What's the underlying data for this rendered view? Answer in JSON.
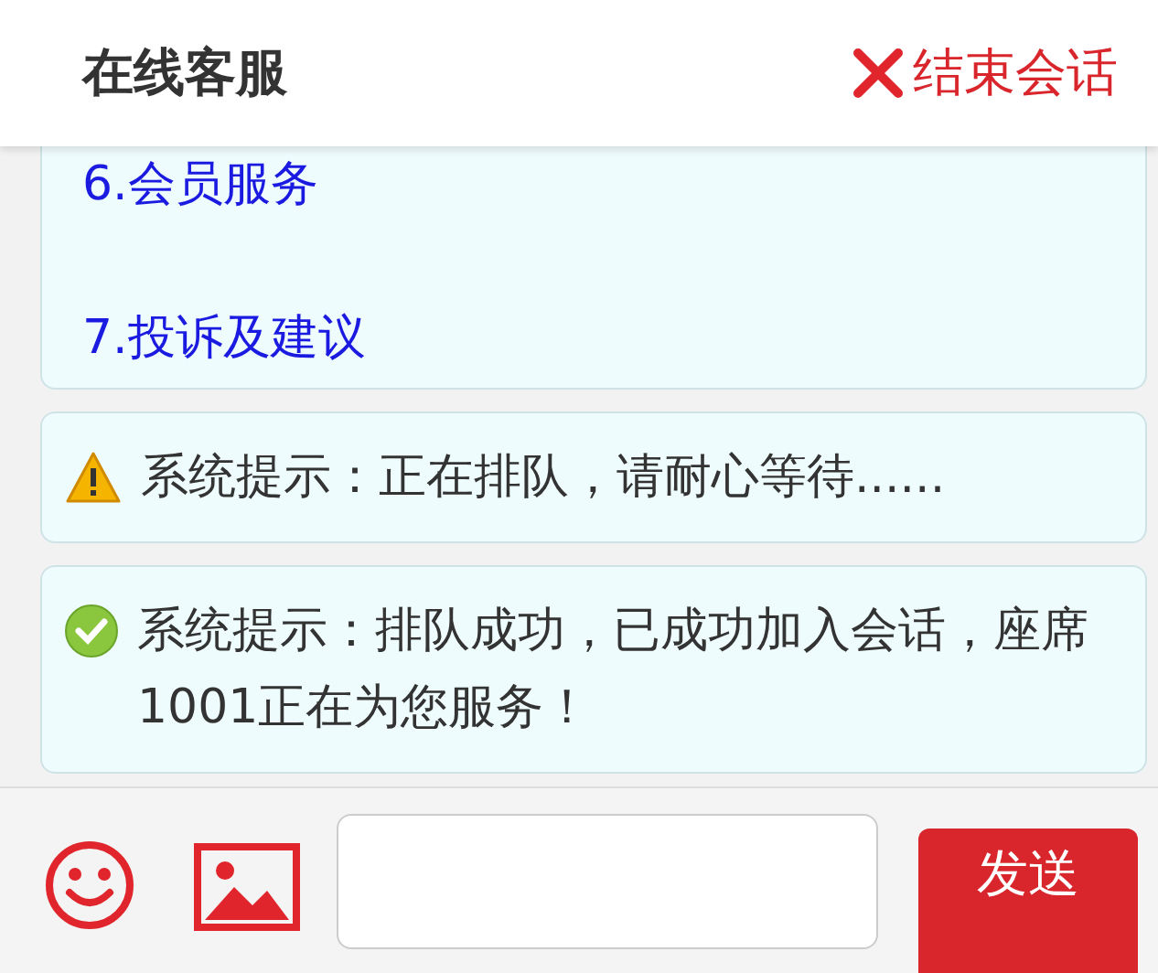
{
  "header": {
    "title": "在线客服",
    "end_button": "结束会话"
  },
  "messages": [
    {
      "kind": "menu",
      "items": [
        "6.会员服务",
        "7.投诉及建议"
      ]
    },
    {
      "kind": "warning",
      "text": "系统提示：正在排队，请耐心等待......"
    },
    {
      "kind": "success",
      "text": "系统提示：排队成功，已成功加入会话，座席1001正在为您服务！"
    }
  ],
  "composer": {
    "send_button": "发送"
  }
}
